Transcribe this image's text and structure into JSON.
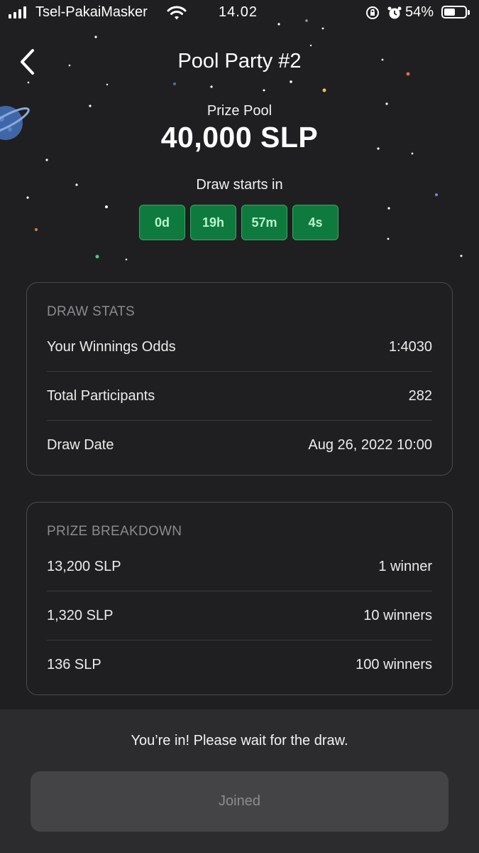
{
  "status_bar": {
    "carrier": "Tsel-PakaiMasker",
    "time": "14.02",
    "battery": "54%",
    "battery_level": 0.54,
    "icons": [
      "signal-icon",
      "wifi-icon",
      "orientation-lock-icon",
      "alarm-icon",
      "battery-icon"
    ]
  },
  "header": {
    "title": "Pool Party #2",
    "back_icon": "chevron-left-icon"
  },
  "prize": {
    "label": "Prize Pool",
    "amount": "40,000 SLP"
  },
  "countdown": {
    "label": "Draw starts in",
    "days": "0d",
    "hours": "19h",
    "minutes": "57m",
    "seconds": "4s"
  },
  "draw_stats": {
    "heading": "DRAW STATS",
    "rows": [
      {
        "label": "Your Winnings Odds",
        "value": "1:4030"
      },
      {
        "label": "Total Participants",
        "value": "282"
      },
      {
        "label": "Draw Date",
        "value": "Aug 26, 2022 10:00"
      }
    ]
  },
  "prize_breakdown": {
    "heading": "PRIZE BREAKDOWN",
    "rows": [
      {
        "label": "13,200 SLP",
        "value": "1 winner"
      },
      {
        "label": "1,320 SLP",
        "value": "10 winners"
      },
      {
        "label": "136 SLP",
        "value": "100 winners"
      }
    ]
  },
  "footer": {
    "message": "You’re in! Please wait for the draw.",
    "button_label": "Joined"
  },
  "colors": {
    "background": "#1f1f21",
    "countdown_green": "#0e7a3e",
    "countdown_text": "#b9f3cc",
    "footer_bg": "#2c2c2e",
    "button_bg": "#444446"
  }
}
